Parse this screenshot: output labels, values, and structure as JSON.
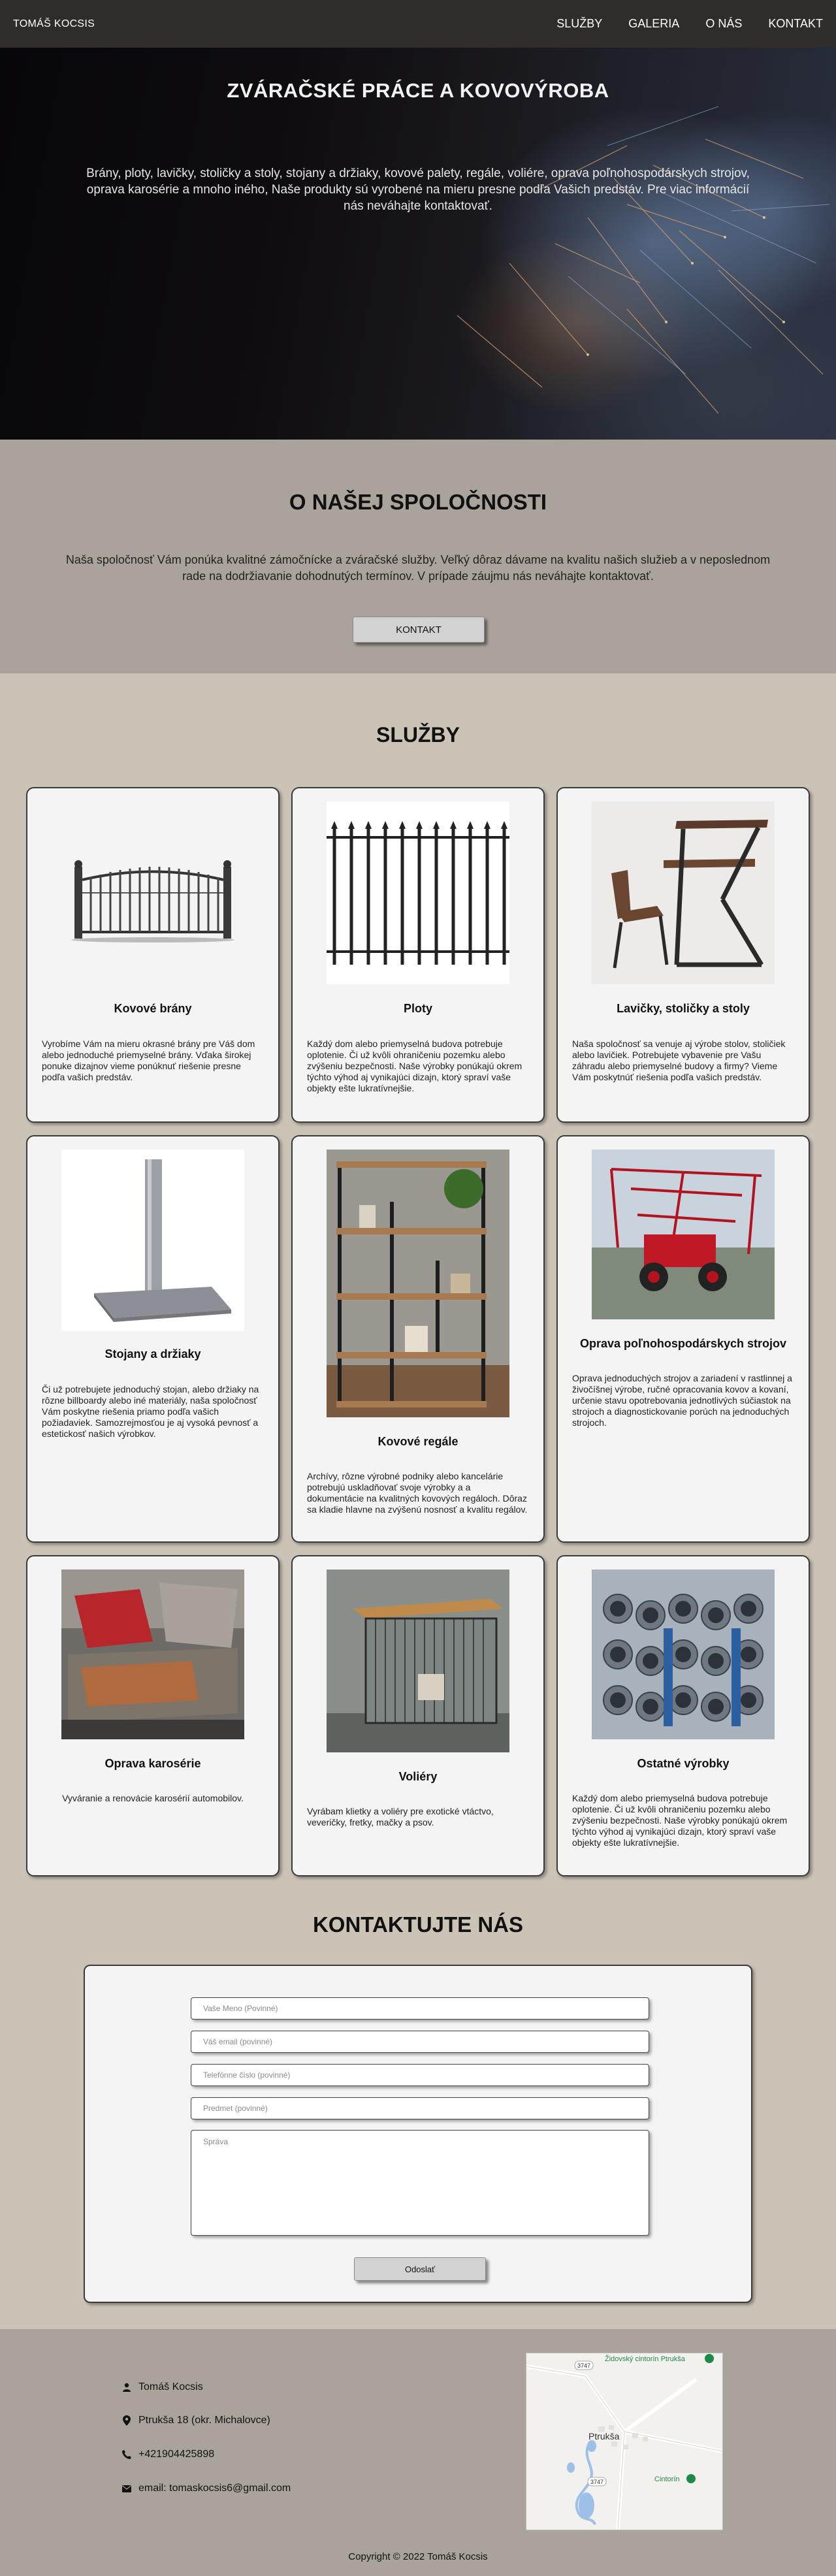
{
  "nav": {
    "brand": "TOMÁŠ KOCSIS",
    "items": [
      {
        "label": "SLUŽBY"
      },
      {
        "label": "GALERIA"
      },
      {
        "label": "O NÁS"
      },
      {
        "label": "KONTAKT"
      }
    ]
  },
  "hero": {
    "title": "ZVÁRAČSKÉ PRÁCE A KOVOVÝROBA",
    "description": "Brány, ploty, lavičky, stoličky a stoly, stojany a držiaky, kovové palety, regále, voliére, oprava poľnohospodárskych strojov, oprava karosérie a mnoho iného, Naše produkty sú vyrobené na mieru presne podľa Vašich predstáv. Pre viac informácií nás neváhajte kontaktovať."
  },
  "about": {
    "title": "O NAŠEJ SPOLOČNOSTI",
    "text": "Naša spoločnosť Vám ponúka kvalitné zámočnícke a zváračské služby. Veľký dôraz dávame na kvalitu našich služieb a v neposlednom rade na dodržiavanie dohodnutých termínov. V prípade záujmu nás neváhajte kontaktovať.",
    "button": "KONTAKT"
  },
  "services": {
    "title": "SLUŽBY",
    "cards": [
      {
        "title": "Kovové brány",
        "text": "Vyrobíme Vám na mieru okrasné brány pre Váš dom alebo jednoduché priemyselné brány. Vďaka širokej ponuke dizajnov vieme ponúknuť riešenie presne podľa vašich predstáv.",
        "image_icon": "gate-image"
      },
      {
        "title": "Ploty",
        "text": "Každý dom alebo priemyselná budova potrebuje oplotenie. Či už kvôli ohraničeniu pozemku alebo zvýšeniu bezpečnosti. Naše výrobky ponúkajú okrem týchto výhod aj vynikajúci dizajn, ktorý spraví vaše objekty ešte lukratívnejšie.",
        "image_icon": "fence-image"
      },
      {
        "title": "Lavičky, stoličky a stoly",
        "text": "Naša spoločnosť sa venuje aj výrobe stolov, stoličiek alebo lavičiek. Potrebujete vybavenie pre Vašu záhradu alebo priemyselné budovy a firmy? Vieme Vám poskytnúť riešenia podľa vašich predstáv.",
        "image_icon": "furniture-image"
      },
      {
        "title": "Stojany a držiaky",
        "text": "Či už potrebujete jednoduchý stojan, alebo držiaky na rôzne billboardy alebo iné materiály, naša spoločnosť Vám poskytne riešenia priamo podľa vašich požiadaviek. Samozrejmosťou je aj vysoká pevnosť a estetickosť našich výrobkov.",
        "image_icon": "stand-image"
      },
      {
        "title": "Kovové regále",
        "text": "Archívy, rôzne výrobné podniky alebo kancelárie potrebujú uskladňovať svoje výrobky a a dokumentácie na kvalitných kovových regáloch. Dôraz sa kladie hlavne na zvýšenú nosnosť a kvalitu regálov.",
        "image_icon": "shelf-image"
      },
      {
        "title": "Oprava poľnohospodárskych strojov",
        "text": "Oprava jednoduchých strojov a zariadení v rastlinnej a živočíšnej výrobe, ručné opracovania kovov a kovaní, určenie stavu opotrebovania jednotlivých súčiastok na strojoch a diagnostickovanie porúch na jednoduchých strojoch.",
        "image_icon": "sprayer-image"
      },
      {
        "title": "Oprava karosérie",
        "text": "Vyváranie a renovácie karosérií automobilov.",
        "image_icon": "car-body-image"
      },
      {
        "title": "Voliéry",
        "text": "Vyrábam klietky a voliéry pre exotické vtáctvo, veveričky, fretky, mačky a psov.",
        "image_icon": "aviary-image"
      },
      {
        "title": "Ostatné výrobky",
        "text": "Každý dom alebo priemyselná budova potrebuje oplotenie. Či už kvôli ohraničeniu pozemku alebo zvýšeniu bezpečnosti. Naše výrobky ponúkajú okrem týchto výhod aj vynikajúci dizajn, ktorý spraví vaše objekty ešte lukratívnejšie.",
        "image_icon": "pipes-image"
      }
    ]
  },
  "contact": {
    "title": "KONTAKTUJTE NÁS",
    "name_placeholder": "Vaše Meno (Povinné)",
    "email_placeholder": "Váš email (povinné)",
    "phone_placeholder": "Telefónne číslo (povinné)",
    "subject_placeholder": "Predmet (povinné)",
    "message_placeholder": "Správa",
    "submit": "Odoslať"
  },
  "footer": {
    "name": "Tomáš Kocsis",
    "address": "Ptrukša 18 (okr. Michalovce)",
    "phone": "+421904425898",
    "email": "email: tomaskocsis6@gmail.com",
    "map_label_town": "Ptrukša",
    "map_label_cemetery_jewish": "Židovský cintorín Ptrukša",
    "map_label_cemetery": "Cintorín",
    "map_road_1": "3747",
    "map_road_2": "3747",
    "copyright": "Copyright © 2022 Tomáš Kocsis"
  }
}
